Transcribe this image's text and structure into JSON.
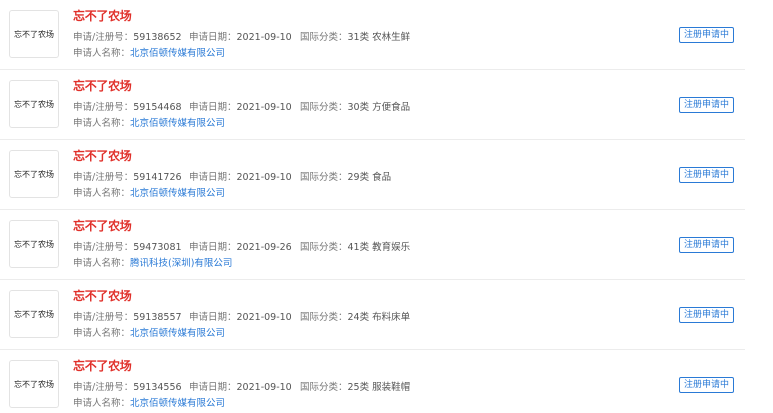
{
  "items": [
    {
      "logo_text": "忘不了农场",
      "name": "忘不了农场",
      "reg_label": "申请/注册号：",
      "reg_no": "59138652",
      "date_label": "申请日期：",
      "date": "2021-09-10",
      "class_label": "国际分类：",
      "class": "31类 农林生鲜",
      "applicant_label": "申请人名称：",
      "applicant": "北京佰顿传媒有限公司",
      "status": "注册申请中"
    },
    {
      "logo_text": "忘不了农场",
      "name": "忘不了农场",
      "reg_label": "申请/注册号：",
      "reg_no": "59154468",
      "date_label": "申请日期：",
      "date": "2021-09-10",
      "class_label": "国际分类：",
      "class": "30类 方便食品",
      "applicant_label": "申请人名称：",
      "applicant": "北京佰顿传媒有限公司",
      "status": "注册申请中"
    },
    {
      "logo_text": "忘不了农场",
      "name": "忘不了农场",
      "reg_label": "申请/注册号：",
      "reg_no": "59141726",
      "date_label": "申请日期：",
      "date": "2021-09-10",
      "class_label": "国际分类：",
      "class": "29类 食品",
      "applicant_label": "申请人名称：",
      "applicant": "北京佰顿传媒有限公司",
      "status": "注册申请中"
    },
    {
      "logo_text": "忘不了农场",
      "name": "忘不了农场",
      "reg_label": "申请/注册号：",
      "reg_no": "59473081",
      "date_label": "申请日期：",
      "date": "2021-09-26",
      "class_label": "国际分类：",
      "class": "41类 教育娱乐",
      "applicant_label": "申请人名称：",
      "applicant": "腾讯科技(深圳)有限公司",
      "status": "注册申请中"
    },
    {
      "logo_text": "忘不了农场",
      "name": "忘不了农场",
      "reg_label": "申请/注册号：",
      "reg_no": "59138557",
      "date_label": "申请日期：",
      "date": "2021-09-10",
      "class_label": "国际分类：",
      "class": "24类 布料床单",
      "applicant_label": "申请人名称：",
      "applicant": "北京佰顿传媒有限公司",
      "status": "注册申请中"
    },
    {
      "logo_text": "忘不了农场",
      "name": "忘不了农场",
      "reg_label": "申请/注册号：",
      "reg_no": "59134556",
      "date_label": "申请日期：",
      "date": "2021-09-10",
      "class_label": "国际分类：",
      "class": "25类 服装鞋帽",
      "applicant_label": "申请人名称：",
      "applicant": "北京佰顿传媒有限公司",
      "status": "注册申请中"
    }
  ]
}
